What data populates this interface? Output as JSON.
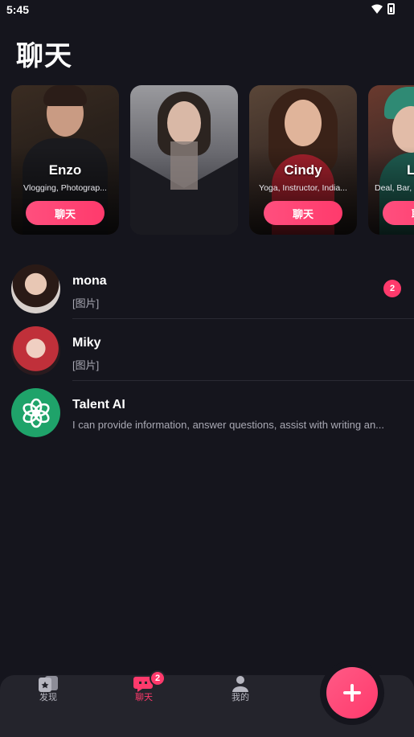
{
  "status_bar": {
    "time": "5:45",
    "icons": [
      "wifi-icon",
      "battery-icon"
    ]
  },
  "page": {
    "title": "聊天"
  },
  "cards": [
    {
      "name": "Enzo",
      "tags": "Vlogging, Photograp...",
      "button": "聊天"
    },
    {
      "name": "",
      "tags": "",
      "button": ""
    },
    {
      "name": "Cindy",
      "tags": "Yoga, Instructor, India...",
      "button": "聊天"
    },
    {
      "name": "Lo",
      "tags": "Deal, Bar, ...",
      "button": "聊天"
    }
  ],
  "chats": [
    {
      "name": "mona",
      "preview": "[图片]",
      "unread": "2"
    },
    {
      "name": "Miky",
      "preview": "[图片]",
      "unread": ""
    },
    {
      "name": "Talent AI",
      "preview": "I can provide information, answer questions, assist with writing an...",
      "unread": ""
    }
  ],
  "bottom_nav": {
    "items": [
      {
        "label": "发现",
        "icon": "discover-icon",
        "active": false
      },
      {
        "label": "聊天",
        "icon": "chat-icon",
        "active": true,
        "badge": "2"
      },
      {
        "label": "我的",
        "icon": "profile-icon",
        "active": false
      }
    ],
    "fab_icon": "plus-icon"
  },
  "colors": {
    "accent": "#ff3a6c",
    "background": "#15151d",
    "nav_background": "#24242c"
  }
}
